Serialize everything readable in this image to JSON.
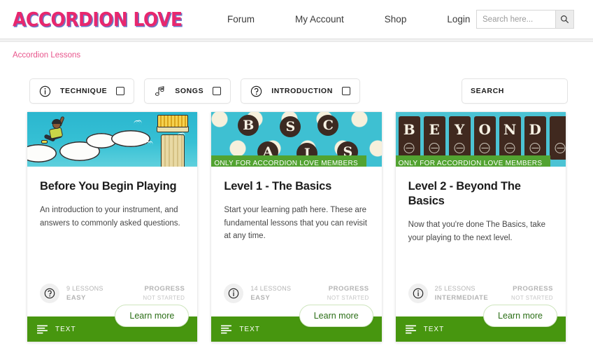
{
  "header": {
    "logo": "ACCORDION LOVE",
    "nav": [
      {
        "label": "Forum"
      },
      {
        "label": "My Account"
      },
      {
        "label": "Shop"
      },
      {
        "label": "Login"
      }
    ],
    "search": {
      "placeholder": "Search here...",
      "value": "",
      "icon": "search-icon"
    }
  },
  "breadcrumb": {
    "label": "Accordion Lessons",
    "color": "#e8558c"
  },
  "filters": {
    "chips": [
      {
        "label": "TECHNIQUE",
        "icon": "info-icon",
        "checked": false
      },
      {
        "label": "SONGS",
        "icon": "music-note-icon",
        "checked": false
      },
      {
        "label": "INTRODUCTION",
        "icon": "question-icon",
        "checked": false
      }
    ],
    "search": {
      "placeholder": "SEARCH",
      "value": "",
      "icon": "search-icon"
    }
  },
  "cards": [
    {
      "id": "before-you-begin-playing",
      "image_alt": "runner leaping toward a column topped with an accordion",
      "ribbon": null,
      "title": "Before You Begin Playing",
      "description": "An introduction to your instrument, and answers to commonly asked questions.",
      "meta_icon": "question-icon",
      "lessons": "9 LESSONS",
      "level": "EASY",
      "progress_label": "PROGRESS",
      "progress_status": "NOT STARTED",
      "footer_label": "TEXT",
      "footer_icon": "text-lines-icon",
      "button": "Learn more"
    },
    {
      "id": "level-1-the-basics",
      "image_alt": "BASICS letters on dark circles over teal polka dots",
      "image_letters_top": [
        "B",
        "S",
        "C"
      ],
      "image_letters_bottom": [
        "A",
        "I",
        "S"
      ],
      "ribbon": "ONLY FOR ACCORDION LOVE MEMBERS",
      "title": "Level 1 - The Basics",
      "description": "Start your learning path here. These are fundamental lessons that you can revisit at any time.",
      "meta_icon": "info-icon",
      "lessons": "14 LESSONS",
      "level": "EASY",
      "progress_label": "PROGRESS",
      "progress_status": "NOT STARTED",
      "footer_label": "TEXT",
      "footer_icon": "text-lines-icon",
      "button": "Learn more"
    },
    {
      "id": "level-2-beyond-the-basics",
      "image_alt": "BEYOND spelled on dark accordion register tiles over teal",
      "image_letters": [
        "B",
        "E",
        "Y",
        "O",
        "N",
        "D"
      ],
      "ribbon": "ONLY FOR ACCORDION LOVE MEMBERS",
      "title": "Level 2 - Beyond The Basics",
      "description": "Now that you're done The Basics, take your playing to the next level.",
      "meta_icon": "info-icon",
      "lessons": "25 LESSONS",
      "level": "INTERMEDIATE",
      "progress_label": "PROGRESS",
      "progress_status": "NOT STARTED",
      "footer_label": "TEXT",
      "footer_icon": "text-lines-icon",
      "button": "Learn more"
    }
  ],
  "colors": {
    "brand_pink": "#e8276e",
    "logo_shadow": "#6a78c8",
    "footer_green": "#47960f",
    "ribbon_green": "#52a331",
    "teal": "#3ec0d2"
  }
}
